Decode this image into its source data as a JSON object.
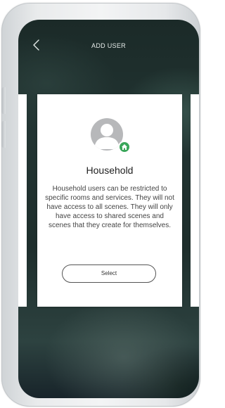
{
  "header": {
    "title": "ADD USER",
    "back_icon": "chevron-left-icon"
  },
  "card": {
    "avatar_icon": "user-avatar-icon",
    "badge_icon": "home-icon",
    "badge_color": "#3aa65a",
    "role_title": "Household",
    "description": "Household users can be restricted to specific rooms and services. They will not have access to all scenes. They will only have access to shared scenes and scenes that they create for themselves.",
    "select_label": "Select"
  }
}
